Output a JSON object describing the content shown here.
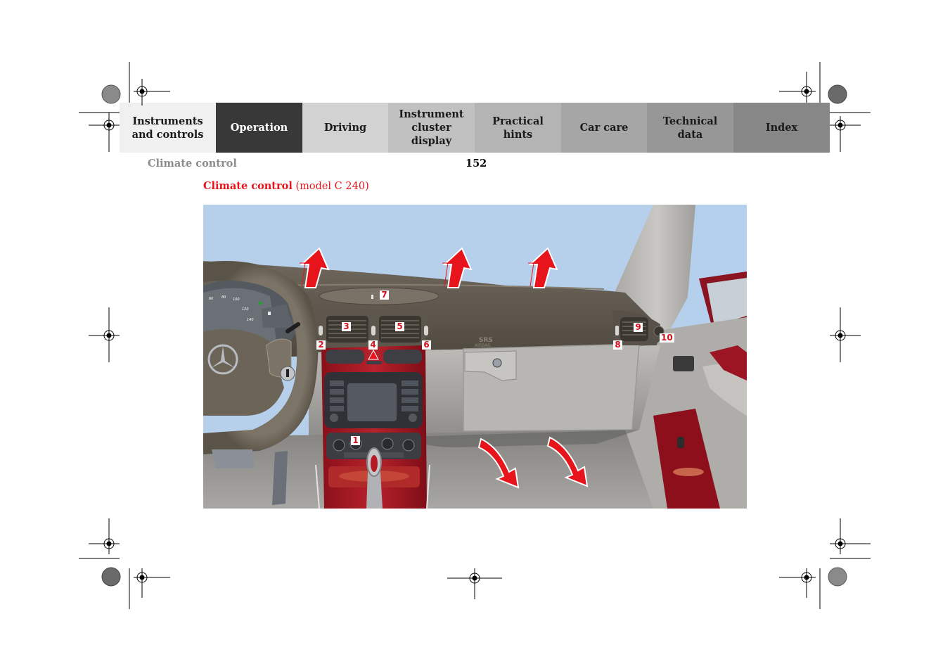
{
  "nav": {
    "tabs": [
      {
        "label": "Instruments\nand controls",
        "color": "#f0f0f0",
        "active": false
      },
      {
        "label": "Operation",
        "color": "#383838",
        "active": true
      },
      {
        "label": "Driving",
        "color": "#d2d2d2",
        "active": false
      },
      {
        "label": "Instrument\ncluster display",
        "color": "#c1c1c1",
        "active": false
      },
      {
        "label": "Practical hints",
        "color": "#b4b4b4",
        "active": false
      },
      {
        "label": "Car care",
        "color": "#a6a6a6",
        "active": false
      },
      {
        "label": "Technical\ndata",
        "color": "#979797",
        "active": false
      },
      {
        "label": "Index",
        "color": "#878787",
        "active": false
      }
    ]
  },
  "header": {
    "section": "Climate control",
    "page_number": "152"
  },
  "document": {
    "title_bold": "Climate control",
    "title_rest": " (model C 240)",
    "accent_color": "#e8141c"
  },
  "illustration": {
    "description": "Dashboard of Mercedes-Benz C 240 showing climate control air vents and outlets",
    "callouts": [
      "1",
      "2",
      "3",
      "4",
      "5",
      "6",
      "7",
      "8",
      "9",
      "10"
    ],
    "airbag_label_line1": "SRS",
    "airbag_label_line2": "AIRBAG",
    "speedo_ticks": [
      "60",
      "80",
      "100",
      "120",
      "140"
    ],
    "airflow_up_arrows": 3,
    "airflow_down_arrows": 2
  }
}
